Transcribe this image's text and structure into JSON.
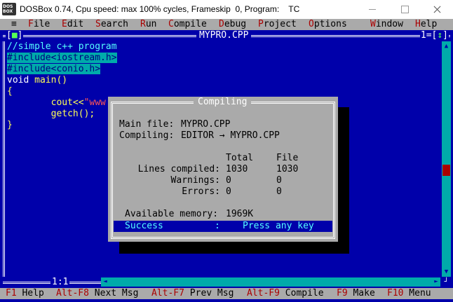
{
  "window": {
    "logo_line1": "DOS",
    "logo_line2": "BOX",
    "title": "DOSBox 0.74, Cpu speed: max 100% cycles, Frameskip  0, Program:    TC"
  },
  "menu": {
    "system": "≡",
    "items": [
      {
        "hot": "F",
        "rest": "ile"
      },
      {
        "hot": "E",
        "rest": "dit"
      },
      {
        "hot": "S",
        "rest": "earch"
      },
      {
        "hot": "R",
        "rest": "un"
      },
      {
        "hot": "C",
        "rest": "ompile"
      },
      {
        "hot": "D",
        "rest": "ebug"
      },
      {
        "hot": "P",
        "rest": "roject"
      },
      {
        "hot": "O",
        "rest": "ptions"
      },
      {
        "hot": "W",
        "rest": "indow"
      },
      {
        "hot": "H",
        "rest": "elp"
      }
    ]
  },
  "editor": {
    "close_left": "[",
    "close_mark": "■",
    "close_right": "]",
    "file_name": "MYPRO.CPP",
    "window_number": "1",
    "zoom_mark": "↕",
    "cursor_position": "1:1",
    "code": {
      "line1": "//simple c++ program",
      "line2": "#include<iostream.h>",
      "line3": "#include<conio.h>",
      "line4_kw": "void",
      "line4_rest": " main()",
      "line5": "{",
      "line6_plain": "        cout<<",
      "line6_str": "\"www",
      "line7": "        getch();",
      "line8": "}"
    }
  },
  "dialog": {
    "title": "Compiling",
    "main_file_label": "Main file:",
    "main_file_value": "MYPRO.CPP",
    "compiling_label": "Compiling:",
    "compiling_value": "EDITOR → MYPRO.CPP",
    "col_total": "Total",
    "col_file": "File",
    "rows": [
      {
        "label": "Lines compiled:",
        "total": "1030",
        "file": "1030"
      },
      {
        "label": "Warnings:",
        "total": "0",
        "file": "0"
      },
      {
        "label": "Errors:",
        "total": "0",
        "file": "0"
      }
    ],
    "memory_label": "Available memory:",
    "memory_value": "1969K",
    "status_left": "Success",
    "status_sep": ":",
    "status_right": "Press any key"
  },
  "statusbar": {
    "items": [
      {
        "key": "F1",
        "label": " Help"
      },
      {
        "key": "Alt-F8",
        "label": " Next Msg"
      },
      {
        "key": "Alt-F7",
        "label": " Prev Msg"
      },
      {
        "key": "Alt-F9",
        "label": " Compile"
      },
      {
        "key": "F9",
        "label": " Make"
      },
      {
        "key": "F10",
        "label": " Menu"
      }
    ]
  },
  "colors": {
    "dos_blue": "#0000aa",
    "dos_gray": "#aaaaaa",
    "dos_cyan": "#00aaaa",
    "hotkey_red": "#aa0000",
    "comment_cyan": "#55ffff",
    "code_yellow": "#ffff55"
  }
}
